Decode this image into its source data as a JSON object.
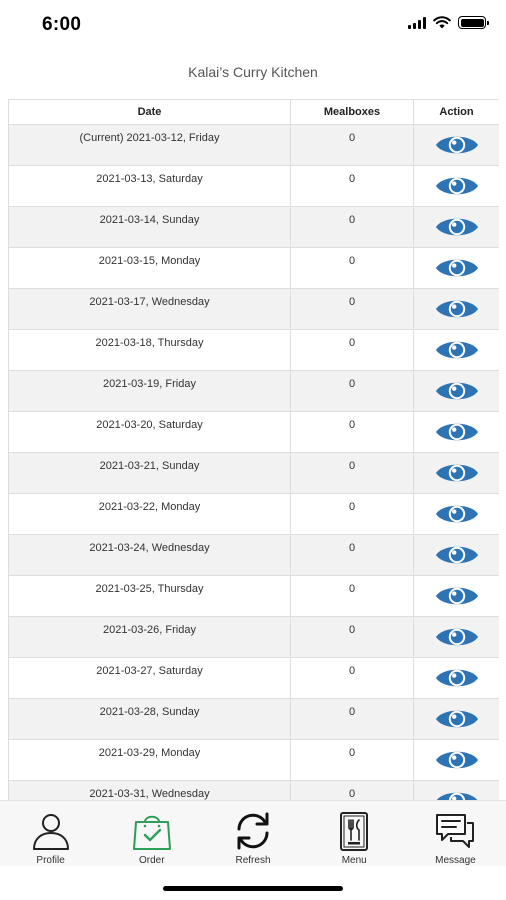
{
  "status_bar": {
    "time": "6:00"
  },
  "header": {
    "title": "Kalai’s Curry Kitchen"
  },
  "table": {
    "columns": [
      "Date",
      "Mealboxes",
      "Action"
    ],
    "rows": [
      {
        "date": "(Current) 2021-03-12, Friday",
        "mealboxes": "0"
      },
      {
        "date": "2021-03-13, Saturday",
        "mealboxes": "0"
      },
      {
        "date": "2021-03-14, Sunday",
        "mealboxes": "0"
      },
      {
        "date": "2021-03-15, Monday",
        "mealboxes": "0"
      },
      {
        "date": "2021-03-17, Wednesday",
        "mealboxes": "0"
      },
      {
        "date": "2021-03-18, Thursday",
        "mealboxes": "0"
      },
      {
        "date": "2021-03-19, Friday",
        "mealboxes": "0"
      },
      {
        "date": "2021-03-20, Saturday",
        "mealboxes": "0"
      },
      {
        "date": "2021-03-21, Sunday",
        "mealboxes": "0"
      },
      {
        "date": "2021-03-22, Monday",
        "mealboxes": "0"
      },
      {
        "date": "2021-03-24, Wednesday",
        "mealboxes": "0"
      },
      {
        "date": "2021-03-25, Thursday",
        "mealboxes": "0"
      },
      {
        "date": "2021-03-26, Friday",
        "mealboxes": "0"
      },
      {
        "date": "2021-03-27, Saturday",
        "mealboxes": "0"
      },
      {
        "date": "2021-03-28, Sunday",
        "mealboxes": "0"
      },
      {
        "date": "2021-03-29, Monday",
        "mealboxes": "0"
      },
      {
        "date": "2021-03-31, Wednesday",
        "mealboxes": "0"
      }
    ],
    "action_icon": "eye-icon"
  },
  "tab_bar": {
    "items": [
      {
        "label": "Profile",
        "icon": "person-icon"
      },
      {
        "label": "Order",
        "icon": "shopping-bag-icon"
      },
      {
        "label": "Refresh",
        "icon": "refresh-icon"
      },
      {
        "label": "Menu",
        "icon": "menu-book-icon"
      },
      {
        "label": "Message",
        "icon": "chat-icon"
      }
    ]
  },
  "colors": {
    "eye_icon": "#2e74b5",
    "order_icon": "#2e9e58",
    "row_stripe": "#f2f2f2",
    "tab_bar_bg": "#f7f7f7"
  }
}
